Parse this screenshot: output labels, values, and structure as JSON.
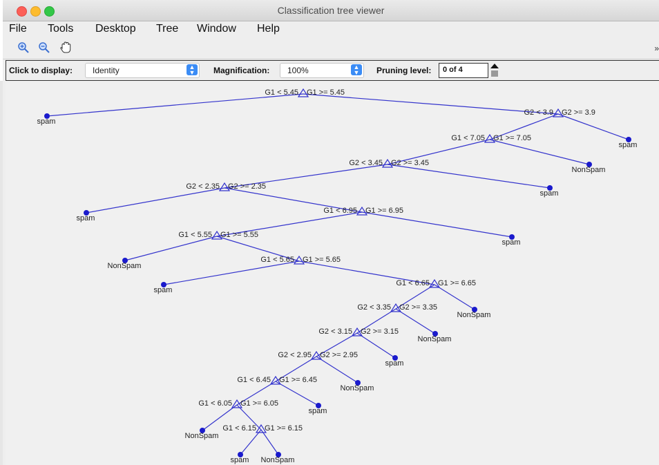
{
  "window": {
    "title": "Classification tree viewer"
  },
  "menu": [
    "File",
    "Tools",
    "Desktop",
    "Tree",
    "Window",
    "Help"
  ],
  "toolbar": {
    "zoom_in": "zoom-in-icon",
    "zoom_out": "zoom-out-icon",
    "pan": "pan-hand-icon",
    "overflow": "»"
  },
  "controls": {
    "click_label": "Click to display:",
    "click_value": "Identity",
    "mag_label": "Magnification:",
    "mag_value": "100%",
    "prune_label": "Pruning level:",
    "prune_value": "0 of 4"
  },
  "colors": {
    "tree": "#3333cc",
    "leaf": "#1a1acc",
    "select_arrow": "#3b8cf5"
  },
  "tree": {
    "nodes": [
      {
        "id": 0,
        "left": "G1 < 5.45",
        "right": "G1 >= 5.45"
      },
      {
        "id": 1,
        "leaf": "spam"
      },
      {
        "id": 2,
        "left": "G2 < 3.9",
        "right": "G2 >= 3.9"
      },
      {
        "id": 3,
        "left": "G1 < 7.05",
        "right": "G1 >= 7.05"
      },
      {
        "id": 4,
        "leaf": "spam"
      },
      {
        "id": 5,
        "left": "G2 < 3.45",
        "right": "G2 >= 3.45"
      },
      {
        "id": 6,
        "leaf": "NonSpam"
      },
      {
        "id": 7,
        "left": "G2 < 2.35",
        "right": "G2 >= 2.35"
      },
      {
        "id": 8,
        "leaf": "spam"
      },
      {
        "id": 9,
        "leaf": "spam"
      },
      {
        "id": 10,
        "left": "G1 < 6.95",
        "right": "G1 >= 6.95"
      },
      {
        "id": 11,
        "left": "G1 < 5.55",
        "right": "G1 >= 5.55"
      },
      {
        "id": 12,
        "leaf": "spam"
      },
      {
        "id": 13,
        "leaf": "NonSpam"
      },
      {
        "id": 14,
        "left": "G1 < 5.65",
        "right": "G1 >= 5.65"
      },
      {
        "id": 15,
        "leaf": "spam"
      },
      {
        "id": 16,
        "left": "G1 < 6.65",
        "right": "G1 >= 6.65"
      },
      {
        "id": 17,
        "left": "G2 < 3.35",
        "right": "G2 >= 3.35"
      },
      {
        "id": 18,
        "leaf": "NonSpam"
      },
      {
        "id": 19,
        "left": "G2 < 3.15",
        "right": "G2 >= 3.15"
      },
      {
        "id": 20,
        "leaf": "NonSpam"
      },
      {
        "id": 21,
        "left": "G2 < 2.95",
        "right": "G2 >= 2.95"
      },
      {
        "id": 22,
        "leaf": "spam"
      },
      {
        "id": 23,
        "left": "G1 < 6.45",
        "right": "G1 >= 6.45"
      },
      {
        "id": 24,
        "leaf": "NonSpam"
      },
      {
        "id": 25,
        "left": "G1 < 6.05",
        "right": "G1 >= 6.05"
      },
      {
        "id": 26,
        "leaf": "spam"
      },
      {
        "id": 27,
        "leaf": "NonSpam"
      },
      {
        "id": 28,
        "left": "G1 < 6.15",
        "right": "G1 >= 6.15"
      },
      {
        "id": 29,
        "leaf": "spam"
      },
      {
        "id": 30,
        "leaf": "NonSpam"
      }
    ],
    "edges": [
      [
        0,
        1
      ],
      [
        0,
        2
      ],
      [
        2,
        3
      ],
      [
        2,
        4
      ],
      [
        3,
        5
      ],
      [
        3,
        6
      ],
      [
        5,
        7
      ],
      [
        5,
        8
      ],
      [
        7,
        9
      ],
      [
        7,
        10
      ],
      [
        10,
        11
      ],
      [
        10,
        12
      ],
      [
        11,
        13
      ],
      [
        11,
        14
      ],
      [
        14,
        15
      ],
      [
        14,
        16
      ],
      [
        16,
        17
      ],
      [
        16,
        18
      ],
      [
        17,
        19
      ],
      [
        17,
        20
      ],
      [
        19,
        21
      ],
      [
        19,
        22
      ],
      [
        21,
        23
      ],
      [
        21,
        24
      ],
      [
        23,
        25
      ],
      [
        23,
        26
      ],
      [
        25,
        27
      ],
      [
        25,
        28
      ],
      [
        28,
        29
      ],
      [
        28,
        30
      ]
    ]
  }
}
